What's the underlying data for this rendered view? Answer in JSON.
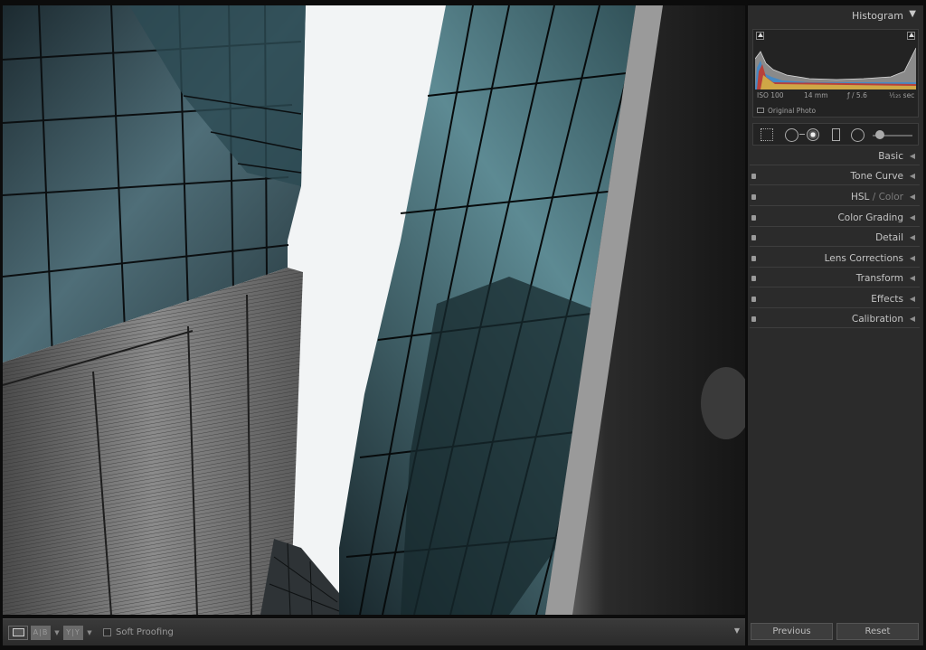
{
  "histogram": {
    "title": "Histogram",
    "exif": {
      "iso": "ISO 100",
      "focal": "14 mm",
      "aperture": "ƒ / 5.6",
      "shutter": "¹⁄₁₂₅ sec"
    },
    "original_label": "Original Photo"
  },
  "panels": [
    {
      "label": "Basic"
    },
    {
      "label": "Tone Curve"
    },
    {
      "label": "HSL",
      "sub": " / Color"
    },
    {
      "label": "Color Grading"
    },
    {
      "label": "Detail"
    },
    {
      "label": "Lens Corrections"
    },
    {
      "label": "Transform"
    },
    {
      "label": "Effects"
    },
    {
      "label": "Calibration"
    }
  ],
  "toolbar": {
    "compare_label": "A|B",
    "survey_label": "Y|Y",
    "soft_proofing_label": "Soft Proofing"
  },
  "buttons": {
    "previous": "Previous",
    "reset": "Reset"
  },
  "icons": {
    "loupe": "loupe-view-icon",
    "compare": "compare-view-icon",
    "survey": "survey-view-icon",
    "crop": "crop-overlay-icon",
    "spot": "spot-removal-icon",
    "redeye": "red-eye-icon",
    "graduated": "graduated-filter-icon",
    "radial": "radial-filter-icon",
    "brush": "adjustment-brush-icon"
  },
  "colors": {
    "panel_bg": "#2b2b2b",
    "toolbar_bg": "#333333",
    "text": "#c8c8c8"
  }
}
